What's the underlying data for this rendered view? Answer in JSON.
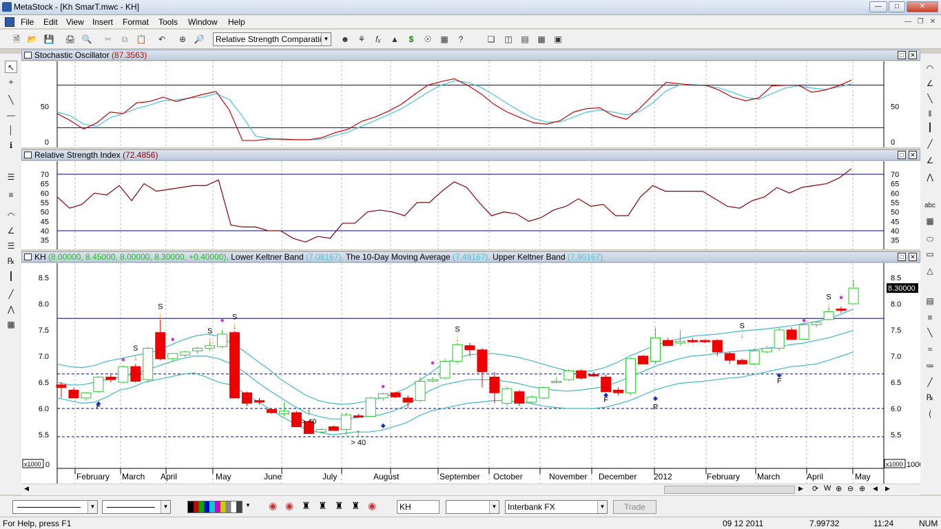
{
  "window": {
    "title": "MetaStock - [Kh SmarT.mwc - KH]"
  },
  "menu": [
    "File",
    "Edit",
    "View",
    "Insert",
    "Format",
    "Tools",
    "Window",
    "Help"
  ],
  "toolbar": {
    "indicator_combo": "Relative Strength Comparatii"
  },
  "panels": {
    "stochastic": {
      "title": "Stochastic Oscillator",
      "value": "(87.3563)",
      "y_ticks": [
        "50",
        "0"
      ]
    },
    "rsi": {
      "title": "Relative Strength Index",
      "value": "(72.4856)",
      "y_ticks": [
        "70",
        "65",
        "60",
        "55",
        "50",
        "45",
        "40",
        "35"
      ]
    },
    "price": {
      "symbol": "KH",
      "ohlc": "(8.00000, 8.45000, 8.00000, 8.30000, +0.40000),",
      "lower_label": "Lower Keltner Band",
      "lower_value": "(7.08167),",
      "ma_label": "The 10-Day Moving Average",
      "ma_value": "(7.49167),",
      "upper_label": "Upper Keltner Band",
      "upper_value": "(7.90167)",
      "y_ticks": [
        "8.5",
        "8.0",
        "7.5",
        "7.0",
        "6.5",
        "6.0",
        "5.5"
      ],
      "last_price": "8.30000",
      "scale_note": "x1000",
      "scale_zero": "0",
      "scale_right": "1000"
    }
  },
  "x_axis": [
    "February",
    "March",
    "April",
    "May",
    "June",
    "July",
    "August",
    "September",
    "October",
    "November",
    "December",
    "2012",
    "February",
    "March",
    "April",
    "May"
  ],
  "annotations": {
    "sell": "S",
    "f": "F",
    "p": "P",
    "gt40": "> 40"
  },
  "bottom": {
    "symbol": "KH",
    "server": "Interbank FX",
    "trade_button": "Trade"
  },
  "status": {
    "help": "For Help, press F1",
    "date": "09 12 2011",
    "price": "7.99732",
    "time": "11:24",
    "num": "NUM"
  },
  "chart_data": [
    {
      "type": "line",
      "title": "Stochastic Oscillator",
      "ylim": [
        0,
        100
      ],
      "hlines": [
        20,
        80
      ],
      "series": [
        {
          "values": [
            40,
            30,
            18,
            27,
            42,
            40,
            55,
            57,
            63,
            57,
            62,
            67,
            71,
            45,
            2,
            2,
            4,
            4,
            3,
            3,
            6,
            13,
            18,
            29,
            35,
            43,
            53,
            67,
            80,
            85,
            89,
            80,
            68,
            53,
            42,
            34,
            27,
            25,
            30,
            42,
            47,
            48,
            37,
            32,
            47,
            66,
            84,
            82,
            80,
            80,
            73,
            63,
            58,
            62,
            79,
            80,
            80,
            70,
            73,
            79,
            87
          ]
        },
        {
          "values": [
            42,
            37,
            25,
            22,
            34,
            40,
            47,
            52,
            58,
            59,
            62,
            63,
            68,
            60,
            36,
            8,
            5,
            3,
            3,
            3,
            4,
            9,
            14,
            22,
            30,
            38,
            47,
            58,
            70,
            80,
            86,
            84,
            77,
            66,
            54,
            43,
            33,
            28,
            28,
            35,
            42,
            45,
            42,
            38,
            43,
            55,
            72,
            80,
            81,
            79,
            76,
            70,
            63,
            60,
            68,
            76,
            79,
            76,
            74,
            77,
            82
          ]
        }
      ]
    },
    {
      "type": "line",
      "title": "Relative Strength Index",
      "ylim": [
        33,
        74
      ],
      "hlines": [
        40,
        70
      ],
      "series": [
        {
          "values": [
            58,
            52,
            54,
            60,
            59,
            64,
            56,
            65,
            61,
            62,
            63,
            64,
            64,
            67,
            43,
            42,
            42,
            40,
            40,
            36,
            34,
            37,
            36,
            44,
            44,
            50,
            51,
            50,
            48,
            55,
            55,
            61,
            66,
            63,
            55,
            48,
            50,
            49,
            45,
            47,
            51,
            53,
            57,
            53,
            54,
            48,
            48,
            58,
            64,
            61,
            61,
            61,
            61,
            57,
            53,
            52,
            56,
            58,
            63,
            60,
            63,
            64,
            65,
            68,
            73
          ]
        }
      ]
    },
    {
      "type": "candlestick",
      "title": "KH",
      "ylim": [
        5.0,
        8.8
      ],
      "hlines": [
        7.72,
        6.66,
        6.0,
        5.46
      ],
      "candles": [
        {
          "o": 6.45,
          "h": 6.5,
          "l": 6.2,
          "c": 6.4
        },
        {
          "o": 6.35,
          "h": 6.4,
          "l": 6.2,
          "c": 6.2
        },
        {
          "o": 6.2,
          "h": 6.32,
          "l": 6.15,
          "c": 6.3
        },
        {
          "o": 6.32,
          "h": 6.62,
          "l": 6.3,
          "c": 6.6
        },
        {
          "o": 6.6,
          "h": 6.65,
          "l": 6.5,
          "c": 6.55
        },
        {
          "o": 6.5,
          "h": 6.82,
          "l": 6.48,
          "c": 6.8
        },
        {
          "o": 6.8,
          "h": 6.85,
          "l": 6.5,
          "c": 6.52
        },
        {
          "o": 6.55,
          "h": 7.18,
          "l": 6.5,
          "c": 7.15
        },
        {
          "o": 7.45,
          "h": 7.7,
          "l": 6.92,
          "c": 6.95
        },
        {
          "o": 6.95,
          "h": 7.05,
          "l": 6.9,
          "c": 7.05
        },
        {
          "o": 7.02,
          "h": 7.1,
          "l": 6.98,
          "c": 7.08
        },
        {
          "o": 7.1,
          "h": 7.18,
          "l": 7.05,
          "c": 7.15
        },
        {
          "o": 7.15,
          "h": 7.25,
          "l": 7.1,
          "c": 7.2
        },
        {
          "o": 7.18,
          "h": 7.5,
          "l": 7.15,
          "c": 7.42
        },
        {
          "o": 7.45,
          "h": 7.48,
          "l": 6.2,
          "c": 6.2
        },
        {
          "o": 6.3,
          "h": 6.32,
          "l": 6.05,
          "c": 6.1
        },
        {
          "o": 6.15,
          "h": 6.2,
          "l": 6.08,
          "c": 6.12
        },
        {
          "o": 5.98,
          "h": 6.0,
          "l": 5.9,
          "c": 5.92
        },
        {
          "o": 5.9,
          "h": 6.12,
          "l": 5.85,
          "c": 5.95
        },
        {
          "o": 5.92,
          "h": 5.95,
          "l": 5.65,
          "c": 5.65
        },
        {
          "o": 5.75,
          "h": 5.78,
          "l": 5.52,
          "c": 5.52
        },
        {
          "o": 5.55,
          "h": 5.62,
          "l": 5.52,
          "c": 5.6
        },
        {
          "o": 5.65,
          "h": 5.67,
          "l": 5.58,
          "c": 5.58
        },
        {
          "o": 5.6,
          "h": 5.92,
          "l": 5.5,
          "c": 5.88
        },
        {
          "o": 5.86,
          "h": 5.9,
          "l": 5.84,
          "c": 5.85
        },
        {
          "o": 5.85,
          "h": 6.22,
          "l": 5.85,
          "c": 6.2
        },
        {
          "o": 6.2,
          "h": 6.3,
          "l": 6.15,
          "c": 6.28
        },
        {
          "o": 6.3,
          "h": 6.32,
          "l": 6.2,
          "c": 6.22
        },
        {
          "o": 6.2,
          "h": 6.25,
          "l": 6.0,
          "c": 6.12
        },
        {
          "o": 6.15,
          "h": 6.6,
          "l": 6.12,
          "c": 6.52
        },
        {
          "o": 6.55,
          "h": 6.6,
          "l": 6.5,
          "c": 6.55
        },
        {
          "o": 6.58,
          "h": 6.95,
          "l": 6.55,
          "c": 6.9
        },
        {
          "o": 6.9,
          "h": 7.25,
          "l": 6.85,
          "c": 7.22
        },
        {
          "o": 7.2,
          "h": 7.25,
          "l": 7.0,
          "c": 7.12
        },
        {
          "o": 7.12,
          "h": 7.15,
          "l": 6.4,
          "c": 6.7
        },
        {
          "o": 6.6,
          "h": 6.7,
          "l": 6.1,
          "c": 6.3
        },
        {
          "o": 6.1,
          "h": 6.42,
          "l": 6.05,
          "c": 6.38
        },
        {
          "o": 6.32,
          "h": 6.35,
          "l": 6.05,
          "c": 6.1
        },
        {
          "o": 6.12,
          "h": 6.25,
          "l": 6.08,
          "c": 6.22
        },
        {
          "o": 6.2,
          "h": 6.42,
          "l": 6.18,
          "c": 6.4
        },
        {
          "o": 6.5,
          "h": 6.6,
          "l": 6.48,
          "c": 6.52
        },
        {
          "o": 6.55,
          "h": 6.75,
          "l": 6.52,
          "c": 6.72
        },
        {
          "o": 6.72,
          "h": 6.75,
          "l": 6.55,
          "c": 6.58
        },
        {
          "o": 6.65,
          "h": 6.7,
          "l": 6.6,
          "c": 6.62
        },
        {
          "o": 6.6,
          "h": 6.65,
          "l": 6.32,
          "c": 6.32
        },
        {
          "o": 6.35,
          "h": 6.4,
          "l": 6.25,
          "c": 6.3
        },
        {
          "o": 6.3,
          "h": 6.98,
          "l": 6.25,
          "c": 6.95
        },
        {
          "o": 7.0,
          "h": 7.02,
          "l": 6.85,
          "c": 6.85
        },
        {
          "o": 6.9,
          "h": 7.55,
          "l": 6.85,
          "c": 7.35
        },
        {
          "o": 7.3,
          "h": 7.35,
          "l": 7.2,
          "c": 7.2
        },
        {
          "o": 7.25,
          "h": 7.5,
          "l": 7.2,
          "c": 7.28
        },
        {
          "o": 7.3,
          "h": 7.35,
          "l": 7.25,
          "c": 7.28
        },
        {
          "o": 7.3,
          "h": 7.32,
          "l": 7.25,
          "c": 7.28
        },
        {
          "o": 7.3,
          "h": 7.32,
          "l": 7.0,
          "c": 7.08
        },
        {
          "o": 7.05,
          "h": 7.08,
          "l": 6.85,
          "c": 6.92
        },
        {
          "o": 6.92,
          "h": 6.95,
          "l": 6.85,
          "c": 6.85
        },
        {
          "o": 6.85,
          "h": 7.15,
          "l": 6.82,
          "c": 7.1
        },
        {
          "o": 7.08,
          "h": 7.2,
          "l": 7.05,
          "c": 7.15
        },
        {
          "o": 7.15,
          "h": 7.55,
          "l": 7.1,
          "c": 7.5
        },
        {
          "o": 7.5,
          "h": 7.55,
          "l": 7.3,
          "c": 7.32
        },
        {
          "o": 7.32,
          "h": 7.62,
          "l": 7.3,
          "c": 7.6
        },
        {
          "o": 7.6,
          "h": 7.66,
          "l": 7.55,
          "c": 7.65
        },
        {
          "o": 7.7,
          "h": 7.9,
          "l": 7.68,
          "c": 7.85
        },
        {
          "o": 7.9,
          "h": 7.95,
          "l": 7.82,
          "c": 7.88
        },
        {
          "o": 8.0,
          "h": 8.45,
          "l": 8.0,
          "c": 8.3
        }
      ],
      "series": [
        {
          "name": "Lower Keltner Band",
          "values": [
            6.2,
            6.15,
            6.1,
            6.12,
            6.22,
            6.35,
            6.4,
            6.5,
            6.55,
            6.6,
            6.65,
            6.68,
            6.6,
            6.5,
            6.45,
            6.3,
            6.15,
            6.0,
            5.85,
            5.72,
            5.6,
            5.55,
            5.5,
            5.52,
            5.55,
            5.55,
            5.58,
            5.65,
            5.72,
            5.85,
            5.95,
            6.0,
            6.05,
            6.1,
            6.12,
            6.15,
            6.15,
            6.13,
            6.1,
            6.05,
            6.02,
            6.0,
            6.0,
            6.0,
            6.02,
            6.08,
            6.15,
            6.25,
            6.35,
            6.42,
            6.48,
            6.5,
            6.52,
            6.55,
            6.58,
            6.6,
            6.65,
            6.7,
            6.75,
            6.8,
            6.82,
            6.85,
            6.92,
            7.0,
            7.08
          ]
        },
        {
          "name": "The 10-Day Moving Average",
          "values": [
            6.5,
            6.45,
            6.45,
            6.5,
            6.55,
            6.6,
            6.65,
            6.72,
            6.8,
            6.88,
            6.95,
            7.0,
            7.0,
            6.95,
            6.85,
            6.7,
            6.52,
            6.35,
            6.2,
            6.05,
            5.92,
            5.85,
            5.8,
            5.8,
            5.82,
            5.85,
            5.88,
            5.95,
            6.05,
            6.2,
            6.35,
            6.45,
            6.5,
            6.55,
            6.55,
            6.55,
            6.52,
            6.48,
            6.42,
            6.38,
            6.35,
            6.33,
            6.35,
            6.38,
            6.42,
            6.5,
            6.6,
            6.7,
            6.8,
            6.88,
            6.95,
            7.0,
            7.02,
            7.05,
            7.08,
            7.1,
            7.12,
            7.15,
            7.18,
            7.22,
            7.25,
            7.3,
            7.35,
            7.42,
            7.49
          ]
        },
        {
          "name": "Upper Keltner Band",
          "values": [
            6.85,
            6.8,
            6.78,
            6.82,
            6.9,
            6.95,
            7.0,
            7.05,
            7.1,
            7.2,
            7.3,
            7.38,
            7.42,
            7.38,
            7.25,
            7.1,
            6.92,
            6.75,
            6.55,
            6.4,
            6.25,
            6.15,
            6.1,
            6.08,
            6.1,
            6.15,
            6.2,
            6.28,
            6.38,
            6.52,
            6.68,
            6.85,
            6.95,
            7.02,
            7.05,
            7.05,
            7.02,
            6.98,
            6.92,
            6.85,
            6.78,
            6.72,
            6.7,
            6.72,
            6.78,
            6.88,
            7.0,
            7.1,
            7.2,
            7.28,
            7.33,
            7.38,
            7.4,
            7.42,
            7.45,
            7.48,
            7.5,
            7.52,
            7.55,
            7.58,
            7.62,
            7.66,
            7.72,
            7.8,
            7.9
          ]
        }
      ]
    }
  ],
  "colors": {
    "stoch_k": "#cc0000",
    "stoch_d": "#46c6d8",
    "rsi": "#880000",
    "band": "#3fb8c8",
    "up": "#22cc22",
    "down": "#ee0000",
    "hline": "#000080"
  }
}
